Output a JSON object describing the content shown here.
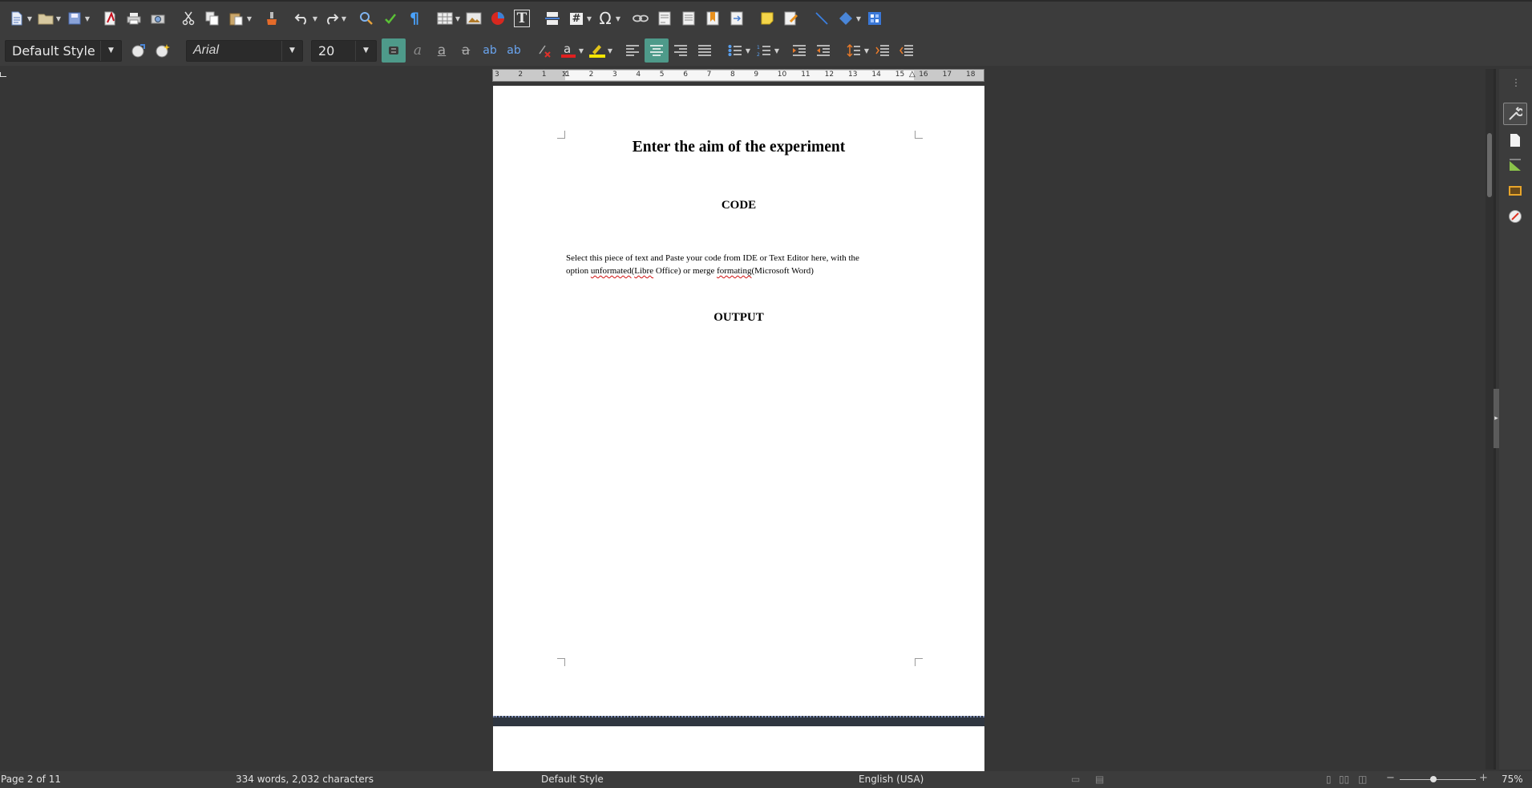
{
  "toolbar_standard": {
    "icons": [
      "new-document-icon",
      "open-folder-icon",
      "save-icon",
      "export-pdf-icon",
      "print-icon",
      "print-preview-icon",
      "cut-icon",
      "copy-icon",
      "paste-icon",
      "clone-formatting-icon",
      "undo-icon",
      "redo-icon",
      "find-replace-icon",
      "spellcheck-icon",
      "formatting-marks-icon",
      "insert-table-icon",
      "insert-image-icon",
      "insert-chart-icon",
      "insert-textbox-icon",
      "insert-page-break-icon",
      "insert-field-icon",
      "insert-special-character-icon",
      "insert-hyperlink-icon",
      "insert-footnote-icon",
      "insert-endnote-icon",
      "insert-bookmark-icon",
      "insert-cross-reference-icon",
      "insert-comment-icon",
      "track-changes-icon",
      "insert-line-icon",
      "basic-shapes-icon",
      "draw-functions-icon"
    ],
    "glyphs": {
      "pilcrow": "¶",
      "omega": "Ω",
      "textbox": "T",
      "field": "#"
    }
  },
  "toolbar_formatting": {
    "paragraph_style": "Default Style",
    "font_name": "Arial",
    "font_size": "20",
    "bold_glyph": "a",
    "superscript_glyph": "ab",
    "subscript_glyph": "ab",
    "font_color_glyph": "a"
  },
  "colors": {
    "accent": "#4e9a8a",
    "font_color_bar": "#e02020",
    "highlight_bar": "#f5e600"
  },
  "ruler": {
    "ticks": [
      "3",
      "2",
      "1",
      "1",
      "2",
      "3",
      "4",
      "5",
      "6",
      "7",
      "8",
      "9",
      "10",
      "11",
      "12",
      "13",
      "14",
      "15",
      "16",
      "17",
      "18"
    ]
  },
  "document": {
    "title": "Enter the aim of the experiment",
    "heading_code": "CODE",
    "paragraph_line1": "Select this piece of text and Paste your code from IDE or Text Editor here, with the",
    "paragraph_line2_pre": "option ",
    "paragraph_line2_err1": "unformated",
    "paragraph_line2_mid1": "(",
    "paragraph_line2_err2": "Libre",
    "paragraph_line2_mid2": " Office) or merge ",
    "paragraph_line2_err3": "formating",
    "paragraph_line2_post": "(Microsoft Word)",
    "heading_output": "OUTPUT"
  },
  "statusbar": {
    "page": "Page 2 of 11",
    "word_count": "334 words, 2,032 characters",
    "page_style": "Default Style",
    "language": "English (USA)",
    "zoom": "75%",
    "zoom_level": 0.75
  }
}
